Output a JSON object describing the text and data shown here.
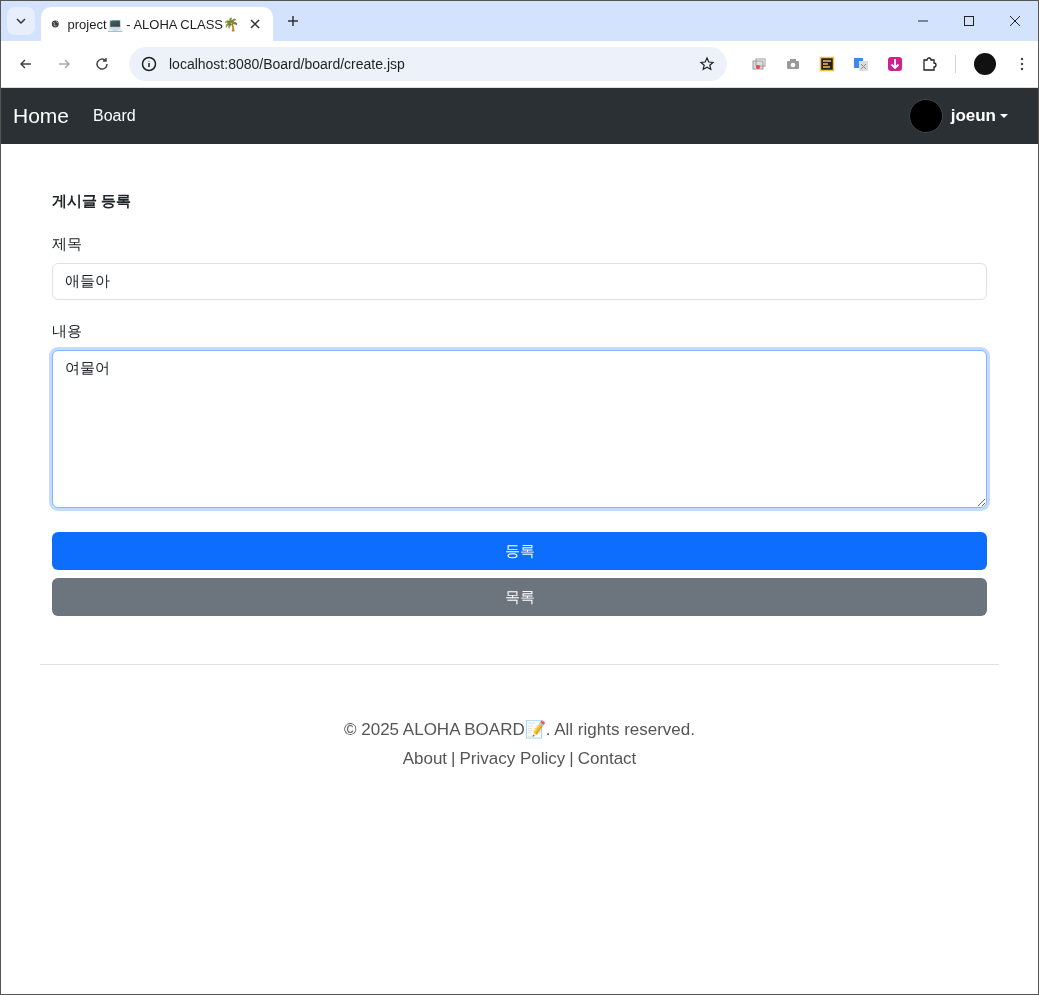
{
  "browser": {
    "tab": {
      "title": "project💻 - ALOHA CLASS🌴"
    },
    "address": "localhost:8080/Board/board/create.jsp"
  },
  "navbar": {
    "brand": "Home",
    "links": [
      "Board"
    ],
    "user": "joeun"
  },
  "form": {
    "heading": "게시글 등록",
    "fields": [
      {
        "kind": "input",
        "label": "제목",
        "value": "애들아",
        "focused": false
      },
      {
        "kind": "textarea",
        "label": "내용",
        "value": "여물어",
        "focused": true
      }
    ],
    "buttons": [
      {
        "label": "등록",
        "kind": "primary"
      },
      {
        "label": "목록",
        "kind": "secondary"
      }
    ]
  },
  "footer": {
    "copyright": "© 2025 ALOHA BOARD📝. All rights reserved.",
    "links": [
      "About",
      "Privacy Policy",
      "Contact"
    ],
    "separators": [
      "|",
      "|"
    ]
  }
}
